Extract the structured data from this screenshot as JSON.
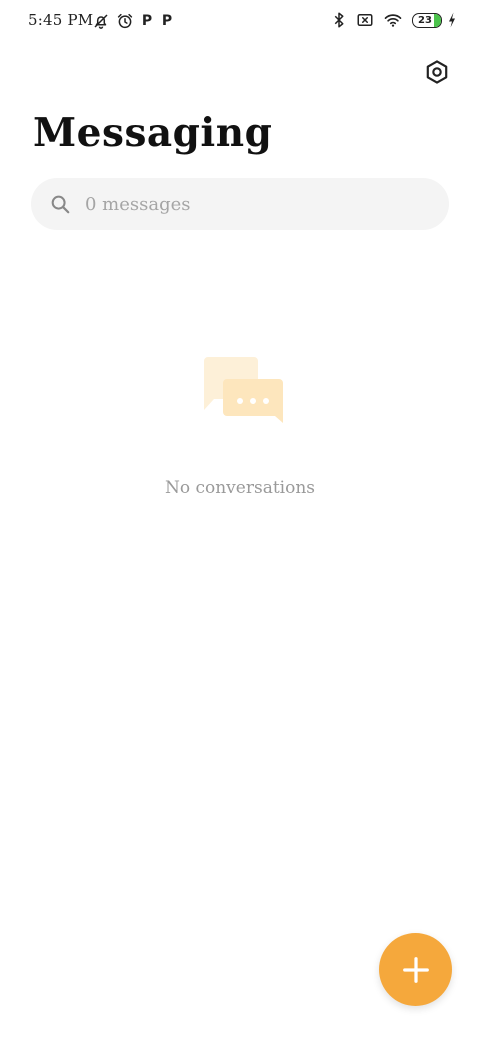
{
  "status_bar": {
    "time": "5:45 PM",
    "battery_level": "23",
    "battery_fill_color": "#4cc34c",
    "icons_left": [
      "muted-notification-icon",
      "alarm-icon",
      "p-app-icon",
      "p-app-icon"
    ],
    "icons_right": [
      "bluetooth-icon",
      "sim-off-icon",
      "wifi-icon",
      "battery-icon",
      "charging-icon"
    ],
    "p_label_1": "P",
    "p_label_2": "P"
  },
  "header": {
    "title": "Messaging",
    "settings_icon": "settings-hexagon-icon"
  },
  "search": {
    "placeholder": "0 messages",
    "icon": "search-icon"
  },
  "empty_state": {
    "illustration": "chat-bubbles-icon",
    "message": "No conversations"
  },
  "fab": {
    "icon": "plus-icon",
    "color": "#f5a83c"
  },
  "colors": {
    "accent": "#f5a83c",
    "search_bg": "#f4f4f4",
    "muted_text": "#9a9a9a"
  }
}
